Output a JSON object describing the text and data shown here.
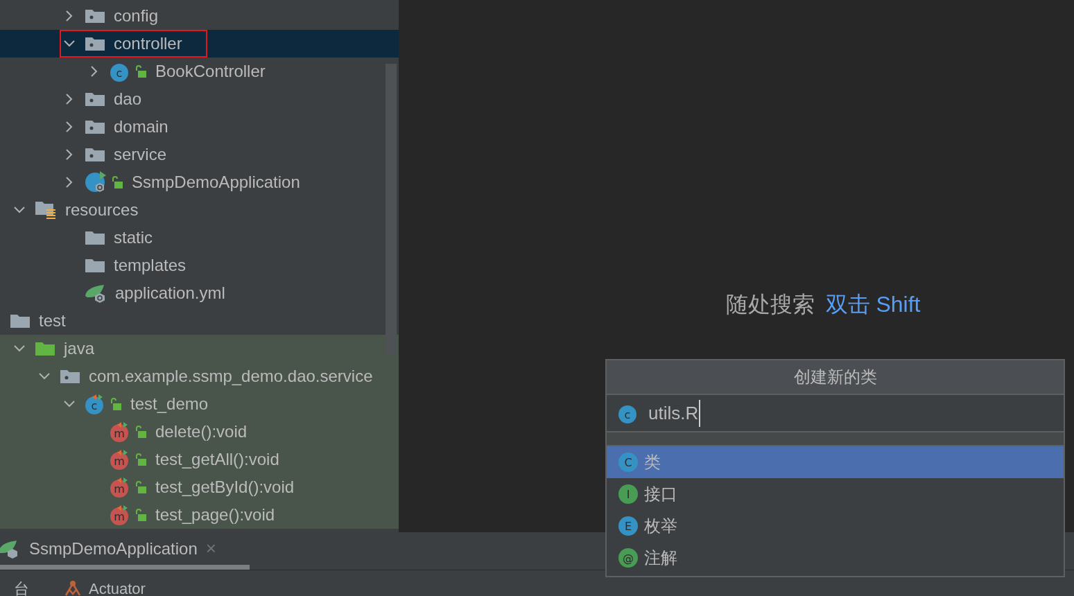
{
  "project_tree": [
    {
      "children": [
        {
          "children": [
            {
              "label": "config",
              "kind": "package",
              "expanded": false,
              "selected": false
            },
            {
              "label": "controller",
              "kind": "package",
              "expanded": true,
              "selected": true,
              "outlined": true,
              "children": [
                {
                  "label": "BookController",
                  "kind": "class",
                  "badge": "c",
                  "public": true,
                  "expanded": false,
                  "selected": false
                }
              ]
            },
            {
              "label": "dao",
              "kind": "package",
              "expanded": false,
              "selected": false
            },
            {
              "label": "domain",
              "kind": "package",
              "expanded": false,
              "selected": false
            },
            {
              "label": "service",
              "kind": "package",
              "expanded": false,
              "selected": false
            },
            {
              "label": "SsmpDemoApplication",
              "kind": "spring_app",
              "public": true,
              "expanded": false,
              "selected": false
            }
          ]
        }
      ]
    },
    {
      "label": "resources",
      "kind": "resources_folder",
      "expanded": true,
      "selected": false,
      "children": [
        {
          "children": [
            {
              "label": "static",
              "kind": "folder",
              "selected": false
            },
            {
              "label": "templates",
              "kind": "folder",
              "selected": false
            },
            {
              "label": "application.yml",
              "kind": "spring_config",
              "selected": false
            }
          ]
        }
      ]
    },
    {
      "label": "test",
      "kind": "folder",
      "selected": false
    },
    {
      "label": "java",
      "kind": "test_folder",
      "expanded": true,
      "selected": false,
      "test_scope": true,
      "children": [
        {
          "label": "com.example.ssmp_demo.dao.service",
          "kind": "package",
          "expanded": true,
          "selected": false,
          "children": [
            {
              "label": "test_demo",
              "kind": "test_class",
              "badge": "c",
              "public": true,
              "expanded": true,
              "selected": false,
              "children": [
                {
                  "label": "delete():void",
                  "kind": "method",
                  "badge": "m",
                  "public": true,
                  "selected": false
                },
                {
                  "label": "test_getAll():void",
                  "kind": "method",
                  "badge": "m",
                  "public": true,
                  "selected": false
                },
                {
                  "label": "test_getById():void",
                  "kind": "method",
                  "badge": "m",
                  "public": true,
                  "selected": false
                },
                {
                  "label": "test_page():void",
                  "kind": "method",
                  "badge": "m",
                  "public": true,
                  "selected": false
                }
              ]
            }
          ]
        }
      ]
    }
  ],
  "editor_hints": [
    {
      "action": "随处搜索",
      "shortcut": "双击 Shift"
    }
  ],
  "run_tabs": [
    {
      "label": "SsmpDemoApplication",
      "close": "×",
      "selected": true
    }
  ],
  "tool_tabs": [
    {
      "label": "台",
      "kind": "text"
    },
    {
      "label": "Actuator",
      "kind": "actuator"
    }
  ],
  "new_class_popup": {
    "title": "创建新的类",
    "value": "utils.R",
    "icon_letter": "c",
    "options": [
      {
        "letter": "C",
        "label": "类",
        "color": "#3592c4",
        "selected": true
      },
      {
        "letter": "I",
        "label": "接口",
        "color": "#499c54",
        "selected": false
      },
      {
        "letter": "E",
        "label": "枚举",
        "color": "#3592c4",
        "selected": false
      },
      {
        "letter": "@",
        "label": "注解",
        "color": "#499c54",
        "selected": false
      }
    ]
  }
}
